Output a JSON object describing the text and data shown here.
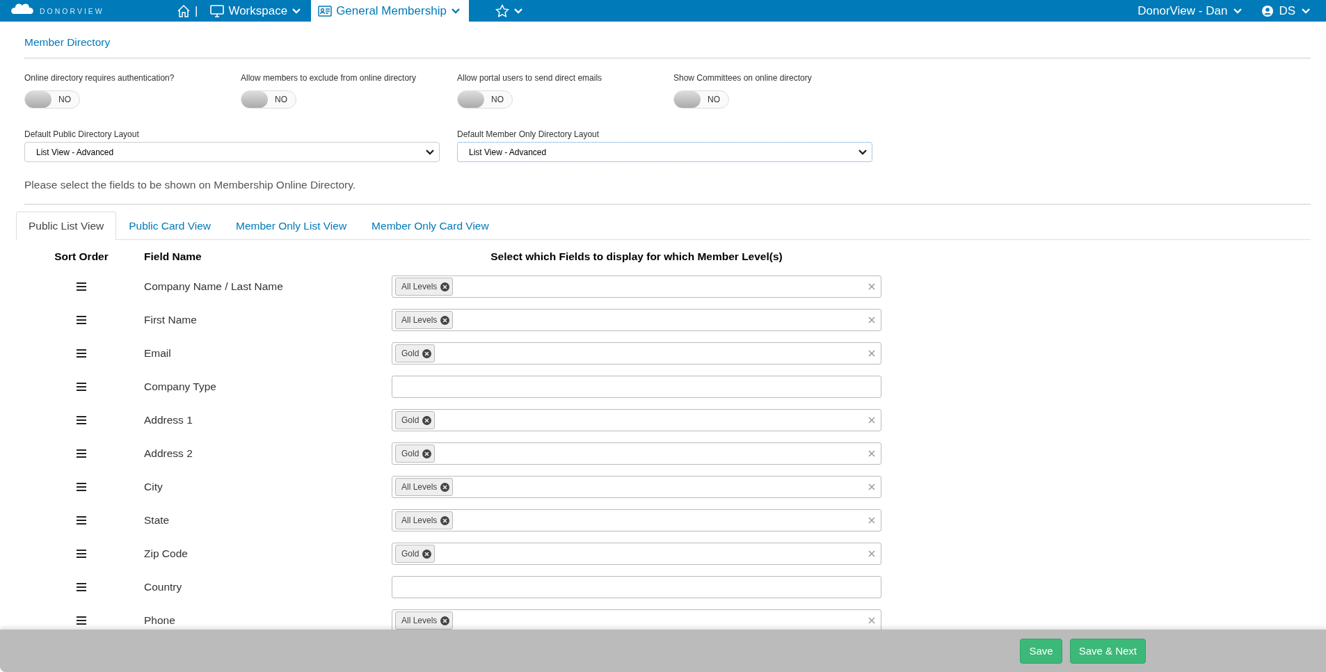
{
  "topbar": {
    "brand": "DONORVIEW",
    "separator": "|",
    "nav": [
      {
        "kind": "home"
      },
      {
        "kind": "menu",
        "label": "Workspace",
        "selected": false
      },
      {
        "kind": "menu",
        "label": "General Membership",
        "selected": true
      },
      {
        "kind": "favorites"
      }
    ],
    "account": "DonorView - Dan",
    "user": "DS"
  },
  "section_title": "Member Directory",
  "toggles": [
    {
      "label": "Online directory requires authentication?",
      "on": false,
      "state_text": "NO"
    },
    {
      "label": "Allow members to exclude from online directory",
      "on": false,
      "state_text": "NO"
    },
    {
      "label": "Allow portal users to send direct emails",
      "on": false,
      "state_text": "NO"
    },
    {
      "label": "Show Committees on online directory",
      "on": false,
      "state_text": "NO"
    }
  ],
  "layouts": [
    {
      "label": "Default Public Directory Layout",
      "value": "List View - Advanced"
    },
    {
      "label": "Default Member Only Directory Layout",
      "value": "List View - Advanced"
    }
  ],
  "instruction": "Please select the fields to be shown on Membership Online Directory.",
  "tabs": [
    {
      "label": "Public List View",
      "selected": true
    },
    {
      "label": "Public Card View",
      "selected": false
    },
    {
      "label": "Member Only List View",
      "selected": false
    },
    {
      "label": "Member Only Card View",
      "selected": false
    }
  ],
  "table": {
    "columns": [
      "Sort Order",
      "Field Name",
      "Select which Fields to display for which Member Level(s)"
    ],
    "rows": [
      {
        "field": "Company Name / Last Name",
        "levels": [
          "All Levels"
        ]
      },
      {
        "field": "First Name",
        "levels": [
          "All Levels"
        ]
      },
      {
        "field": "Email",
        "levels": [
          "Gold"
        ]
      },
      {
        "field": "Company Type",
        "levels": []
      },
      {
        "field": "Address 1",
        "levels": [
          "Gold"
        ]
      },
      {
        "field": "Address 2",
        "levels": [
          "Gold"
        ]
      },
      {
        "field": "City",
        "levels": [
          "All Levels"
        ]
      },
      {
        "field": "State",
        "levels": [
          "All Levels"
        ]
      },
      {
        "field": "Zip Code",
        "levels": [
          "Gold"
        ]
      },
      {
        "field": "Country",
        "levels": []
      },
      {
        "field": "Phone",
        "levels": [
          "All Levels"
        ]
      }
    ]
  },
  "footer": {
    "buttons": [
      "Save",
      "Save & Next"
    ]
  }
}
